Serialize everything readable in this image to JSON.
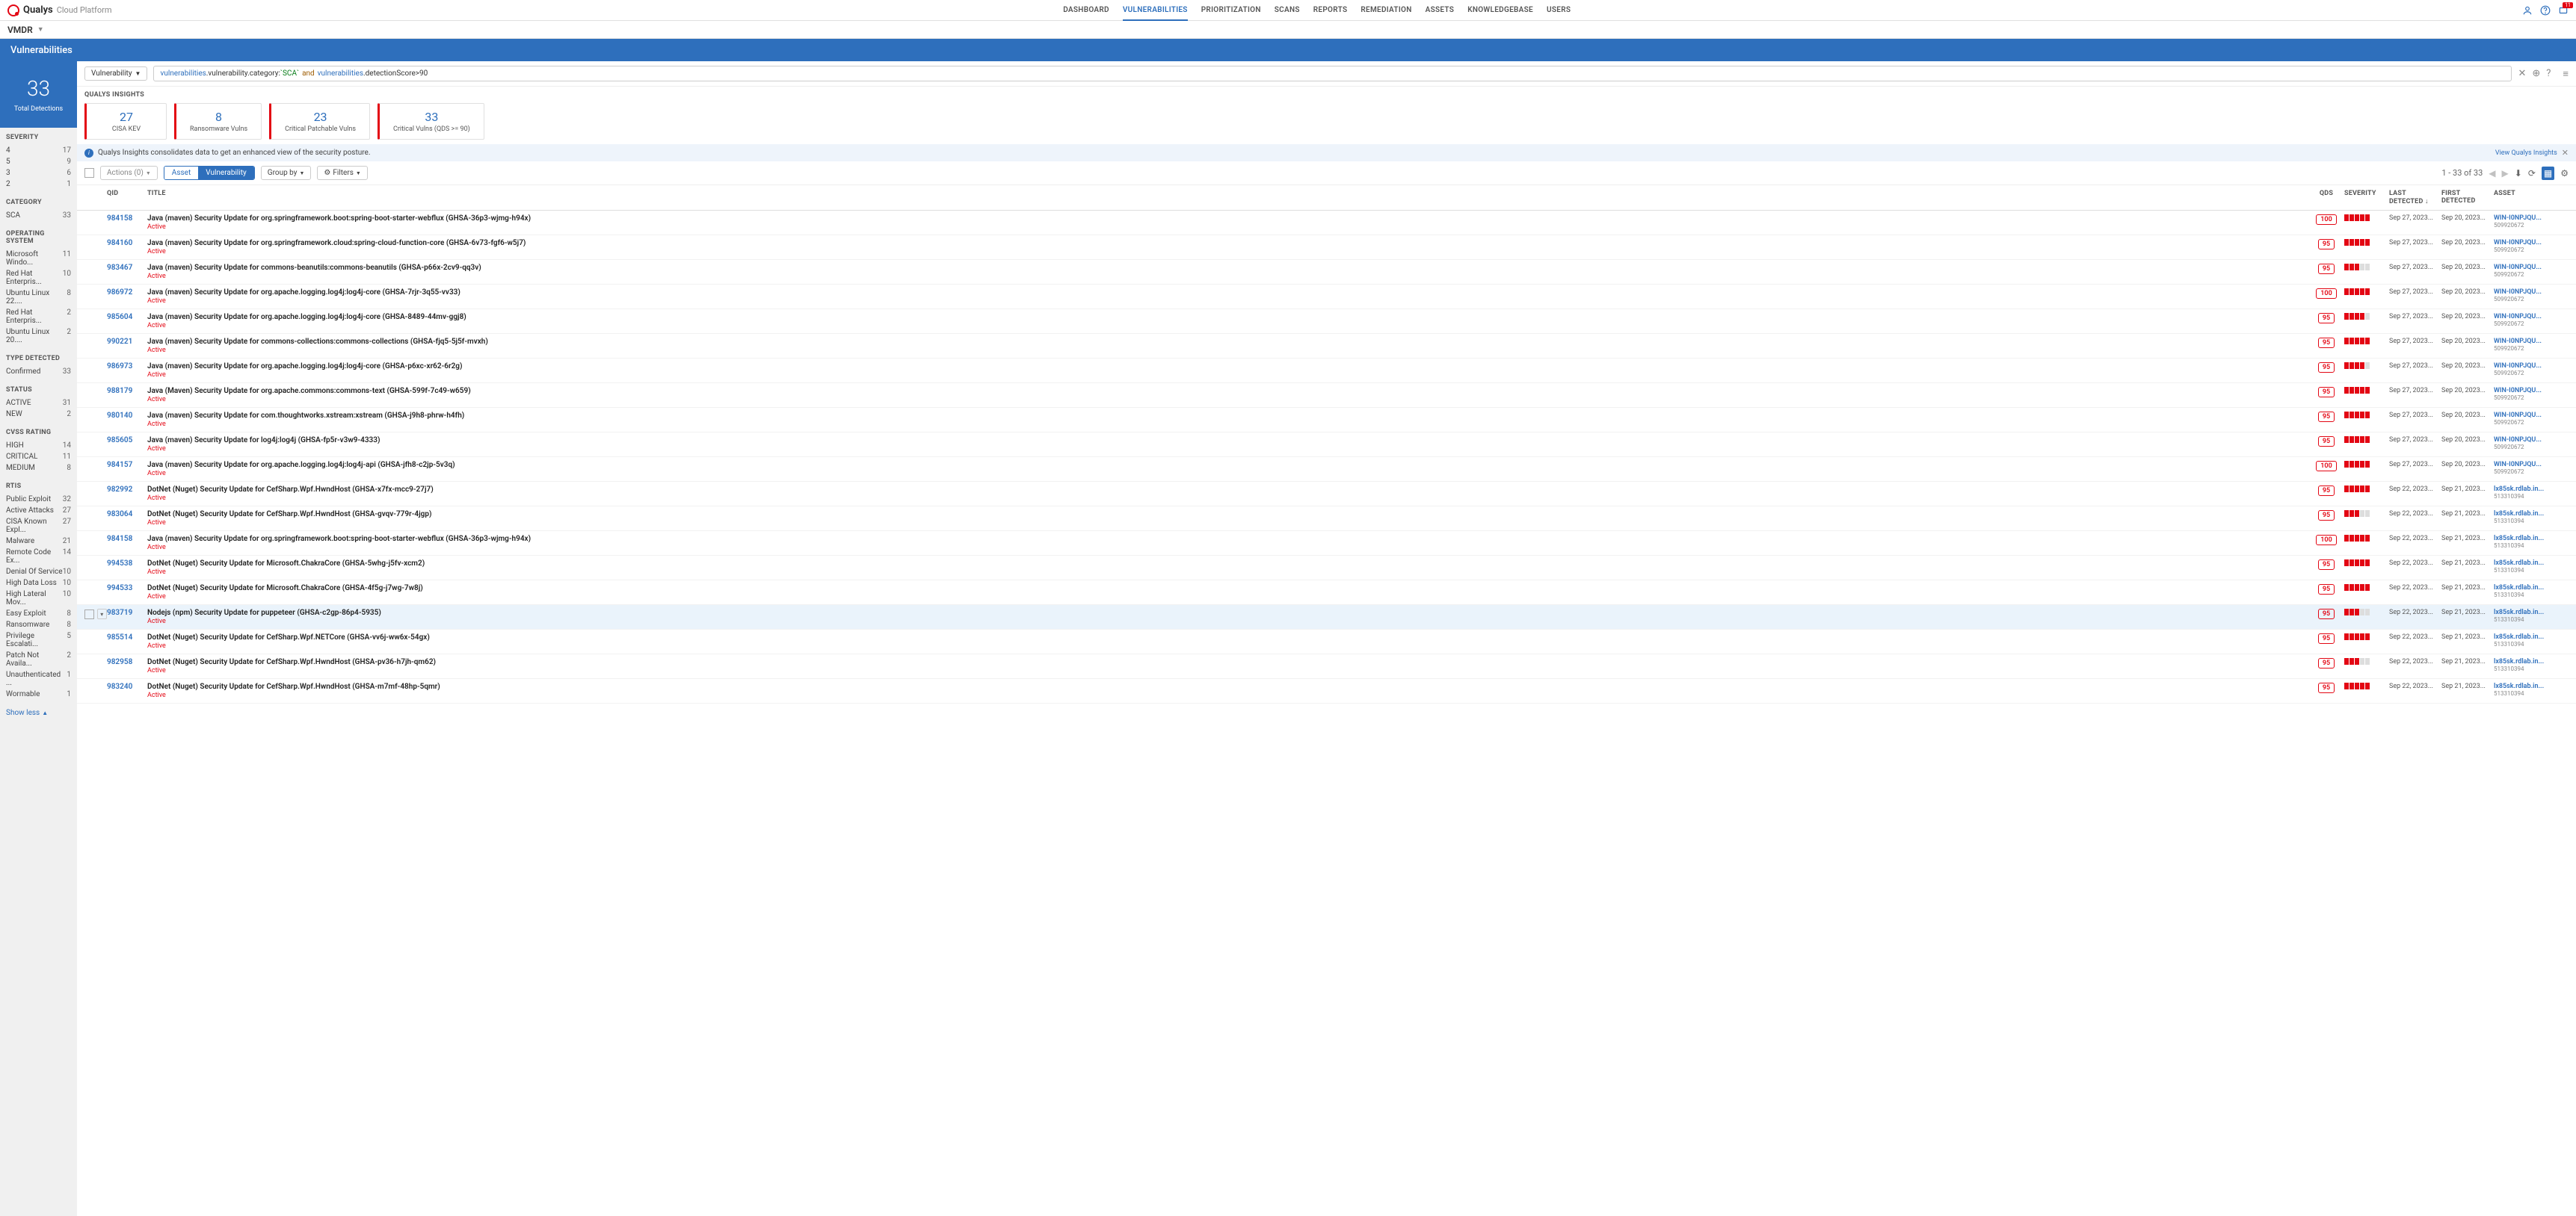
{
  "brand": {
    "name": "Qualys",
    "suffix": "Cloud Platform"
  },
  "module": "VMDR",
  "page_title": "Vulnerabilities",
  "topnav": [
    "DASHBOARD",
    "VULNERABILITIES",
    "PRIORITIZATION",
    "SCANS",
    "REPORTS",
    "REMEDIATION",
    "ASSETS",
    "KNOWLEDGEBASE",
    "USERS"
  ],
  "topnav_active": 1,
  "notif_count": "11",
  "total": {
    "value": "33",
    "label": "Total Detections"
  },
  "query": {
    "scope": "Vulnerability",
    "parts": [
      {
        "t": "kw",
        "v": "vulnerabilities"
      },
      {
        "t": "plain",
        "v": ".vulnerability.category:"
      },
      {
        "t": "str",
        "v": "`SCA`"
      },
      {
        "t": "op",
        "v": "and"
      },
      {
        "t": "kw",
        "v": "vulnerabilities"
      },
      {
        "t": "plain",
        "v": ".detectionScore>"
      },
      {
        "t": "plain",
        "v": "90"
      }
    ]
  },
  "insights": {
    "head": "QUALYS INSIGHTS",
    "cards": [
      {
        "num": "27",
        "lbl": "CISA KEV"
      },
      {
        "num": "8",
        "lbl": "Ransomware Vulns"
      },
      {
        "num": "23",
        "lbl": "Critical Patchable Vulns"
      },
      {
        "num": "33",
        "lbl": "Critical Vulns (QDS >= 90)"
      }
    ],
    "info": "Qualys Insights consolidates data to get an enhanced view of the security posture.",
    "view": "View Qualys Insights"
  },
  "toolbar": {
    "actions": "Actions (0)",
    "asset": "Asset",
    "vuln": "Vulnerability",
    "groupby": "Group by",
    "filters": "Filters",
    "pager": "1 - 33 of  33"
  },
  "columns": {
    "qid": "QID",
    "title": "TITLE",
    "qds": "QDS",
    "sev": "SEVERITY",
    "ld": "LAST DETECTED",
    "fd": "FIRST DETECTED",
    "asset": "ASSET"
  },
  "filters": [
    {
      "head": "SEVERITY",
      "items": [
        {
          "l": "4",
          "c": "17"
        },
        {
          "l": "5",
          "c": "9"
        },
        {
          "l": "3",
          "c": "6"
        },
        {
          "l": "2",
          "c": "1"
        }
      ]
    },
    {
      "head": "CATEGORY",
      "items": [
        {
          "l": "SCA",
          "c": "33"
        }
      ]
    },
    {
      "head": "OPERATING SYSTEM",
      "items": [
        {
          "l": "Microsoft Windo...",
          "c": "11"
        },
        {
          "l": "Red Hat Enterpris...",
          "c": "10"
        },
        {
          "l": "Ubuntu Linux 22....",
          "c": "8"
        },
        {
          "l": "Red Hat Enterpris...",
          "c": "2"
        },
        {
          "l": "Ubuntu Linux 20....",
          "c": "2"
        }
      ]
    },
    {
      "head": "TYPE DETECTED",
      "items": [
        {
          "l": "Confirmed",
          "c": "33"
        }
      ]
    },
    {
      "head": "STATUS",
      "items": [
        {
          "l": "ACTIVE",
          "c": "31"
        },
        {
          "l": "NEW",
          "c": "2"
        }
      ]
    },
    {
      "head": "CVSS RATING",
      "items": [
        {
          "l": "HIGH",
          "c": "14"
        },
        {
          "l": "CRITICAL",
          "c": "11"
        },
        {
          "l": "MEDIUM",
          "c": "8"
        }
      ]
    },
    {
      "head": "RTIS",
      "items": [
        {
          "l": "Public Exploit",
          "c": "32"
        },
        {
          "l": "Active Attacks",
          "c": "27"
        },
        {
          "l": "CISA Known Expl...",
          "c": "27"
        },
        {
          "l": "Malware",
          "c": "21"
        },
        {
          "l": "Remote Code Ex...",
          "c": "14"
        },
        {
          "l": "Denial Of Service",
          "c": "10"
        },
        {
          "l": "High Data Loss",
          "c": "10"
        },
        {
          "l": "High Lateral Mov...",
          "c": "10"
        },
        {
          "l": "Easy Exploit",
          "c": "8"
        },
        {
          "l": "Ransomware",
          "c": "8"
        },
        {
          "l": "Privilege Escalati...",
          "c": "5"
        },
        {
          "l": "Patch Not Availa...",
          "c": "2"
        },
        {
          "l": "Unauthenticated ...",
          "c": "1"
        },
        {
          "l": "Wormable",
          "c": "1"
        }
      ]
    }
  ],
  "showless": "Show less",
  "hover_row": 16,
  "rows": [
    {
      "qid": "984158",
      "title": "Java (maven) Security Update for org.springframework.boot:spring-boot-starter-webflux (GHSA-36p3-wjmg-h94x)",
      "status": "Active",
      "qds": "100",
      "sev": 5,
      "ld": "Sep 27, 2023...",
      "fd": "Sep 20, 2023...",
      "asset": "WIN-I0NPJQU...",
      "assetsub": "509920672"
    },
    {
      "qid": "984160",
      "title": "Java (maven) Security Update for org.springframework.cloud:spring-cloud-function-core (GHSA-6v73-fgf6-w5j7)",
      "status": "Active",
      "qds": "95",
      "sev": 5,
      "ld": "Sep 27, 2023...",
      "fd": "Sep 20, 2023...",
      "asset": "WIN-I0NPJQU...",
      "assetsub": "509920672"
    },
    {
      "qid": "983467",
      "title": "Java (maven) Security Update for commons-beanutils:commons-beanutils (GHSA-p66x-2cv9-qq3v)",
      "status": "Active",
      "qds": "95",
      "sev": 3,
      "ld": "Sep 27, 2023...",
      "fd": "Sep 20, 2023...",
      "asset": "WIN-I0NPJQU...",
      "assetsub": "509920672"
    },
    {
      "qid": "986972",
      "title": "Java (maven) Security Update for org.apache.logging.log4j:log4j-core (GHSA-7rjr-3q55-vv33)",
      "status": "Active",
      "qds": "100",
      "sev": 5,
      "ld": "Sep 27, 2023...",
      "fd": "Sep 20, 2023...",
      "asset": "WIN-I0NPJQU...",
      "assetsub": "509920672"
    },
    {
      "qid": "985604",
      "title": "Java (maven) Security Update for org.apache.logging.log4j:log4j-core (GHSA-8489-44mv-ggj8)",
      "status": "Active",
      "qds": "95",
      "sev": 4,
      "ld": "Sep 27, 2023...",
      "fd": "Sep 20, 2023...",
      "asset": "WIN-I0NPJQU...",
      "assetsub": "509920672"
    },
    {
      "qid": "990221",
      "title": "Java (maven) Security Update for commons-collections:commons-collections (GHSA-fjq5-5j5f-mvxh)",
      "status": "Active",
      "qds": "95",
      "sev": 5,
      "ld": "Sep 27, 2023...",
      "fd": "Sep 20, 2023...",
      "asset": "WIN-I0NPJQU...",
      "assetsub": "509920672"
    },
    {
      "qid": "986973",
      "title": "Java (maven) Security Update for org.apache.logging.log4j:log4j-core (GHSA-p6xc-xr62-6r2g)",
      "status": "Active",
      "qds": "95",
      "sev": 4,
      "ld": "Sep 27, 2023...",
      "fd": "Sep 20, 2023...",
      "asset": "WIN-I0NPJQU...",
      "assetsub": "509920672"
    },
    {
      "qid": "988179",
      "title": "Java (Maven) Security Update for org.apache.commons:commons-text (GHSA-599f-7c49-w659)",
      "status": "Active",
      "qds": "95",
      "sev": 5,
      "ld": "Sep 27, 2023...",
      "fd": "Sep 20, 2023...",
      "asset": "WIN-I0NPJQU...",
      "assetsub": "509920672"
    },
    {
      "qid": "980140",
      "title": "Java (maven) Security Update for com.thoughtworks.xstream:xstream (GHSA-j9h8-phrw-h4fh)",
      "status": "Active",
      "qds": "95",
      "sev": 5,
      "ld": "Sep 27, 2023...",
      "fd": "Sep 20, 2023...",
      "asset": "WIN-I0NPJQU...",
      "assetsub": "509920672"
    },
    {
      "qid": "985605",
      "title": "Java (maven) Security Update for log4j:log4j (GHSA-fp5r-v3w9-4333)",
      "status": "Active",
      "qds": "95",
      "sev": 5,
      "ld": "Sep 27, 2023...",
      "fd": "Sep 20, 2023...",
      "asset": "WIN-I0NPJQU...",
      "assetsub": "509920672"
    },
    {
      "qid": "984157",
      "title": "Java (maven) Security Update for org.apache.logging.log4j:log4j-api (GHSA-jfh8-c2jp-5v3q)",
      "status": "Active",
      "qds": "100",
      "sev": 5,
      "ld": "Sep 27, 2023...",
      "fd": "Sep 20, 2023...",
      "asset": "WIN-I0NPJQU...",
      "assetsub": "509920672"
    },
    {
      "qid": "982992",
      "title": "DotNet (Nuget) Security Update for CefSharp.Wpf.HwndHost (GHSA-x7fx-mcc9-27j7)",
      "status": "Active",
      "qds": "95",
      "sev": 5,
      "ld": "Sep 22, 2023...",
      "fd": "Sep 21, 2023...",
      "asset": "lx85sk.rdlab.in...",
      "assetsub": "513310394"
    },
    {
      "qid": "983064",
      "title": "DotNet (Nuget) Security Update for CefSharp.Wpf.HwndHost (GHSA-gvqv-779r-4jgp)",
      "status": "Active",
      "qds": "95",
      "sev": 3,
      "ld": "Sep 22, 2023...",
      "fd": "Sep 21, 2023...",
      "asset": "lx85sk.rdlab.in...",
      "assetsub": "513310394"
    },
    {
      "qid": "984158",
      "title": "Java (maven) Security Update for org.springframework.boot:spring-boot-starter-webflux (GHSA-36p3-wjmg-h94x)",
      "status": "Active",
      "qds": "100",
      "sev": 5,
      "ld": "Sep 22, 2023...",
      "fd": "Sep 21, 2023...",
      "asset": "lx85sk.rdlab.in...",
      "assetsub": "513310394"
    },
    {
      "qid": "994538",
      "title": "DotNet (Nuget) Security Update for Microsoft.ChakraCore (GHSA-5whg-j5fv-xcm2)",
      "status": "Active",
      "qds": "95",
      "sev": 5,
      "ld": "Sep 22, 2023...",
      "fd": "Sep 21, 2023...",
      "asset": "lx85sk.rdlab.in...",
      "assetsub": "513310394"
    },
    {
      "qid": "994533",
      "title": "DotNet (Nuget) Security Update for Microsoft.ChakraCore (GHSA-4f5g-j7wg-7w8j)",
      "status": "Active",
      "qds": "95",
      "sev": 5,
      "ld": "Sep 22, 2023...",
      "fd": "Sep 21, 2023...",
      "asset": "lx85sk.rdlab.in...",
      "assetsub": "513310394"
    },
    {
      "qid": "983719",
      "title": "Nodejs (npm) Security Update for puppeteer (GHSA-c2gp-86p4-5935)",
      "status": "Active",
      "qds": "95",
      "sev": 3,
      "ld": "Sep 22, 2023...",
      "fd": "Sep 21, 2023...",
      "asset": "lx85sk.rdlab.in...",
      "assetsub": "513310394"
    },
    {
      "qid": "985514",
      "title": "DotNet (Nuget) Security Update for CefSharp.Wpf.NETCore (GHSA-vv6j-ww6x-54gx)",
      "status": "Active",
      "qds": "95",
      "sev": 5,
      "ld": "Sep 22, 2023...",
      "fd": "Sep 21, 2023...",
      "asset": "lx85sk.rdlab.in...",
      "assetsub": "513310394"
    },
    {
      "qid": "982958",
      "title": "DotNet (Nuget) Security Update for CefSharp.Wpf.HwndHost (GHSA-pv36-h7jh-qm62)",
      "status": "Active",
      "qds": "95",
      "sev": 3,
      "ld": "Sep 22, 2023...",
      "fd": "Sep 21, 2023...",
      "asset": "lx85sk.rdlab.in...",
      "assetsub": "513310394"
    },
    {
      "qid": "983240",
      "title": "DotNet (Nuget) Security Update for CefSharp.Wpf.HwndHost (GHSA-m7mf-48hp-5qmr)",
      "status": "Active",
      "qds": "95",
      "sev": 5,
      "ld": "Sep 22, 2023...",
      "fd": "Sep 21, 2023...",
      "asset": "lx85sk.rdlab.in...",
      "assetsub": "513310394"
    }
  ]
}
